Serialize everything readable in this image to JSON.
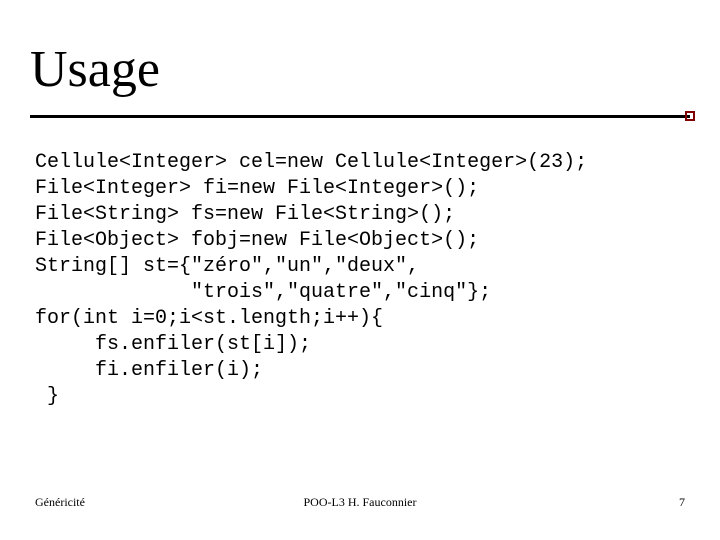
{
  "title": "Usage",
  "code": "Cellule<Integer> cel=new Cellule<Integer>(23);\nFile<Integer> fi=new File<Integer>();\nFile<String> fs=new File<String>();\nFile<Object> fobj=new File<Object>();\nString[] st={\"zéro\",\"un\",\"deux\",\n             \"trois\",\"quatre\",\"cinq\"};\nfor(int i=0;i<st.length;i++){\n     fs.enfiler(st[i]);\n     fi.enfiler(i);\n }",
  "footer": {
    "left": "Généricité",
    "center": "POO-L3 H. Fauconnier",
    "right": "7"
  }
}
